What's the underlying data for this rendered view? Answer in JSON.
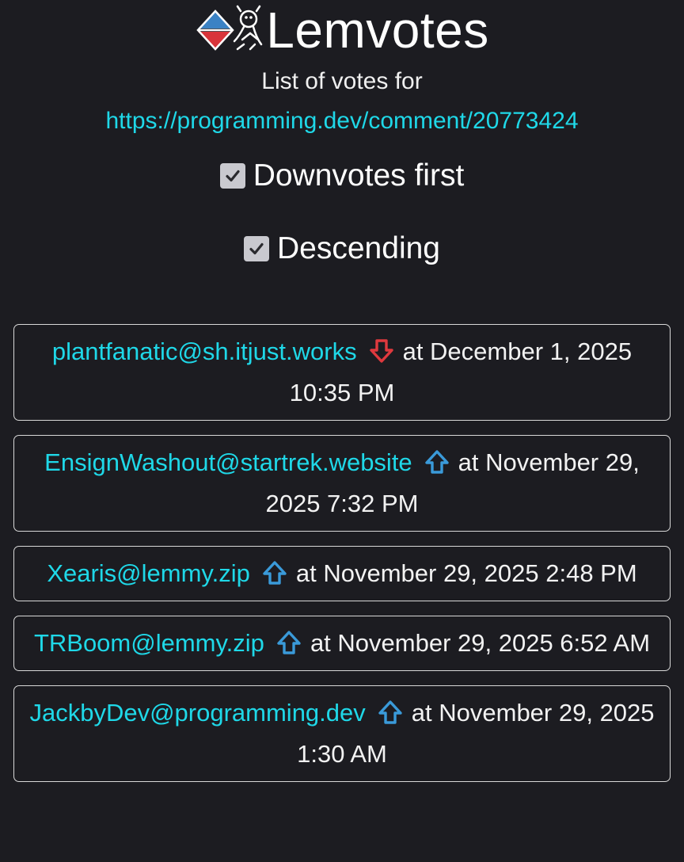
{
  "app": {
    "title": "Lemvotes"
  },
  "subtitle": {
    "prefix": "List of votes for ",
    "link_text": "https://programming.dev/comment/20773424"
  },
  "options": [
    {
      "label": "Downvotes first",
      "checked": true
    },
    {
      "label": "Descending",
      "checked": true
    }
  ],
  "votes": [
    {
      "user": "plantfanatic@sh.itjust.works",
      "type": "downvote",
      "time": "at December 1, 2025 10:35 PM"
    },
    {
      "user": "EnsignWashout@startrek.website",
      "type": "upvote",
      "time": "at November 29, 2025 7:32 PM"
    },
    {
      "user": "Xearis@lemmy.zip",
      "type": "upvote",
      "time": "at November 29, 2025 2:48 PM"
    },
    {
      "user": "TRBoom@lemmy.zip",
      "type": "upvote",
      "time": "at November 29, 2025 6:52 AM"
    },
    {
      "user": "JackbyDev@programming.dev",
      "type": "upvote",
      "time": "at November 29, 2025 1:30 AM"
    }
  ],
  "colors": {
    "background": "#1c1c21",
    "link": "#1fd8e8",
    "upvote": "#3a9ad9",
    "downvote": "#e0393e"
  }
}
